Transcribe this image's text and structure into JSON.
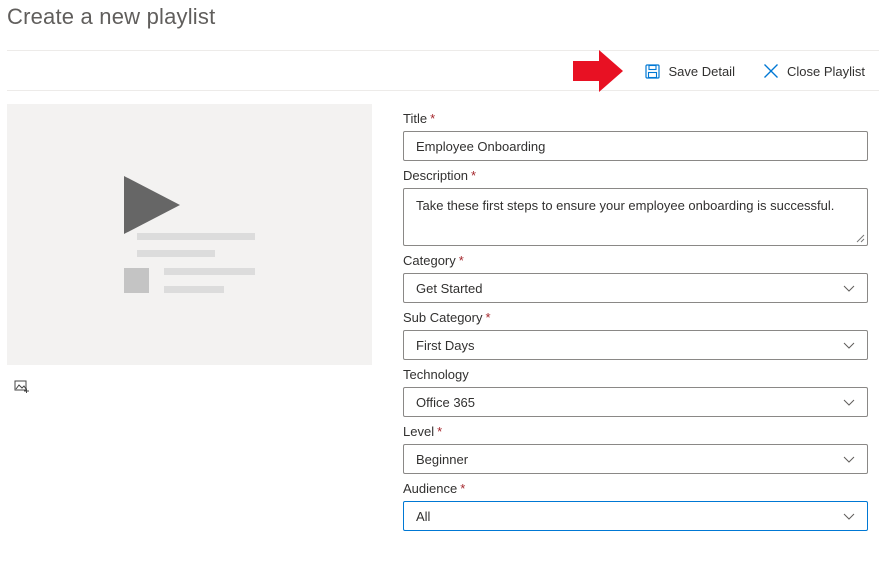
{
  "page": {
    "title": "Create a new playlist"
  },
  "toolbar": {
    "save_label": "Save Detail",
    "close_label": "Close Playlist",
    "save_icon": "save-icon",
    "close_icon": "close-icon",
    "accent_color": "#0078d4"
  },
  "annotation": {
    "arrow_color": "#e81123"
  },
  "thumbnail": {
    "placeholder_icon": "video-placeholder",
    "change_image_icon": "image-edit-icon"
  },
  "form": {
    "title": {
      "label": "Title",
      "required": "*",
      "value": "Employee Onboarding"
    },
    "description": {
      "label": "Description",
      "required": "*",
      "value": "Take these first steps to ensure your employee onboarding is successful."
    },
    "category": {
      "label": "Category",
      "required": "*",
      "value": "Get Started"
    },
    "sub_category": {
      "label": "Sub Category",
      "required": "*",
      "value": "First Days"
    },
    "technology": {
      "label": "Technology",
      "value": "Office 365"
    },
    "level": {
      "label": "Level",
      "required": "*",
      "value": "Beginner"
    },
    "audience": {
      "label": "Audience",
      "required": "*",
      "value": "All"
    }
  }
}
